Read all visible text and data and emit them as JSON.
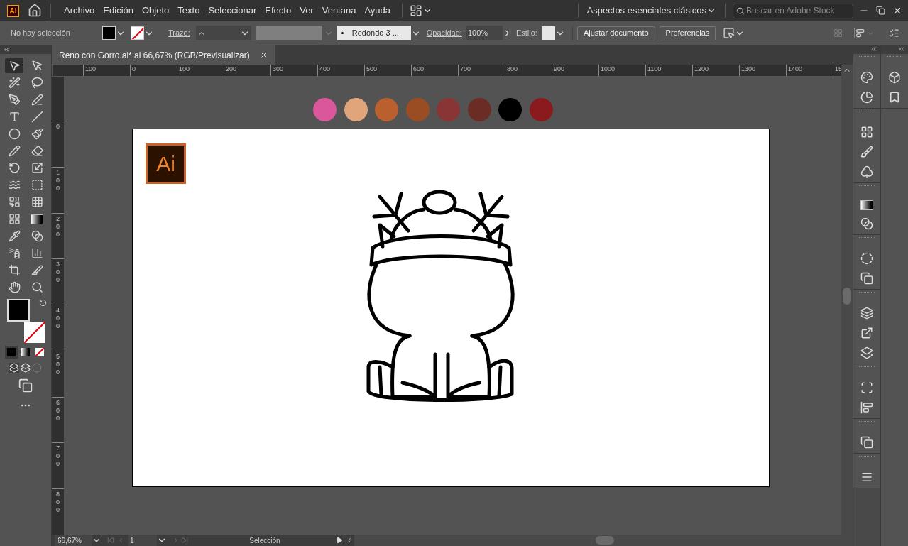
{
  "app_icon": "Ai",
  "menu": [
    "Archivo",
    "Edición",
    "Objeto",
    "Texto",
    "Seleccionar",
    "Efecto",
    "Ver",
    "Ventana",
    "Ayuda"
  ],
  "workspace": "Aspectos esenciales clásicos",
  "search": {
    "placeholder": "Buscar en Adobe Stock"
  },
  "control_bar": {
    "selection": "No hay selección",
    "stroke_label": "Trazo:",
    "brush": "Redondo 3 ...",
    "opacity_label": "Opacidad:",
    "opacity": "100%",
    "style_label": "Estilo:",
    "buttons": [
      "Ajustar documento",
      "Preferencias"
    ]
  },
  "document_tab": {
    "title": "Reno con Gorro.ai* al 66,67% (RGB/Previsualizar)"
  },
  "tools": [
    {
      "selected": true
    },
    {
      "selected": false
    },
    {
      "selected": false
    },
    {
      "selected": false
    },
    {
      "selected": false
    },
    {
      "selected": false
    },
    {
      "selected": false
    },
    {
      "selected": false
    },
    {
      "selected": false
    },
    {
      "selected": false
    },
    {
      "selected": false
    },
    {
      "selected": false
    },
    {
      "selected": false
    },
    {
      "selected": false
    },
    {
      "selected": false
    },
    {
      "selected": false
    },
    {
      "selected": false
    },
    {
      "selected": false
    },
    {
      "selected": false
    },
    {
      "selected": false
    },
    {
      "selected": false
    },
    {
      "selected": false
    },
    {
      "selected": false
    },
    {
      "selected": false
    },
    {
      "selected": false
    },
    {
      "selected": false
    },
    {
      "selected": false
    },
    {
      "selected": false
    }
  ],
  "rulers": {
    "horizontal": [
      "100",
      "0",
      "100",
      "200",
      "300",
      "400",
      "500",
      "600",
      "700",
      "800",
      "900",
      "1000",
      "1100",
      "1200",
      "1300",
      "1400",
      "15"
    ],
    "vertical": [
      "0",
      "100",
      "200",
      "300",
      "400",
      "500",
      "600",
      "700",
      "800"
    ]
  },
  "swatches": [
    {
      "color": "#d9579a"
    },
    {
      "color": "#e0a57a"
    },
    {
      "color": "#b9602e"
    },
    {
      "color": "#9a4d22"
    },
    {
      "color": "#8a3535"
    },
    {
      "color": "#6b2c25"
    },
    {
      "color": "#000000"
    },
    {
      "color": "#8b1a1f"
    }
  ],
  "artboard": {
    "logo": "Ai"
  },
  "status_bar": {
    "zoom": "66,67%",
    "artboard": "1",
    "tool": "Selección"
  }
}
